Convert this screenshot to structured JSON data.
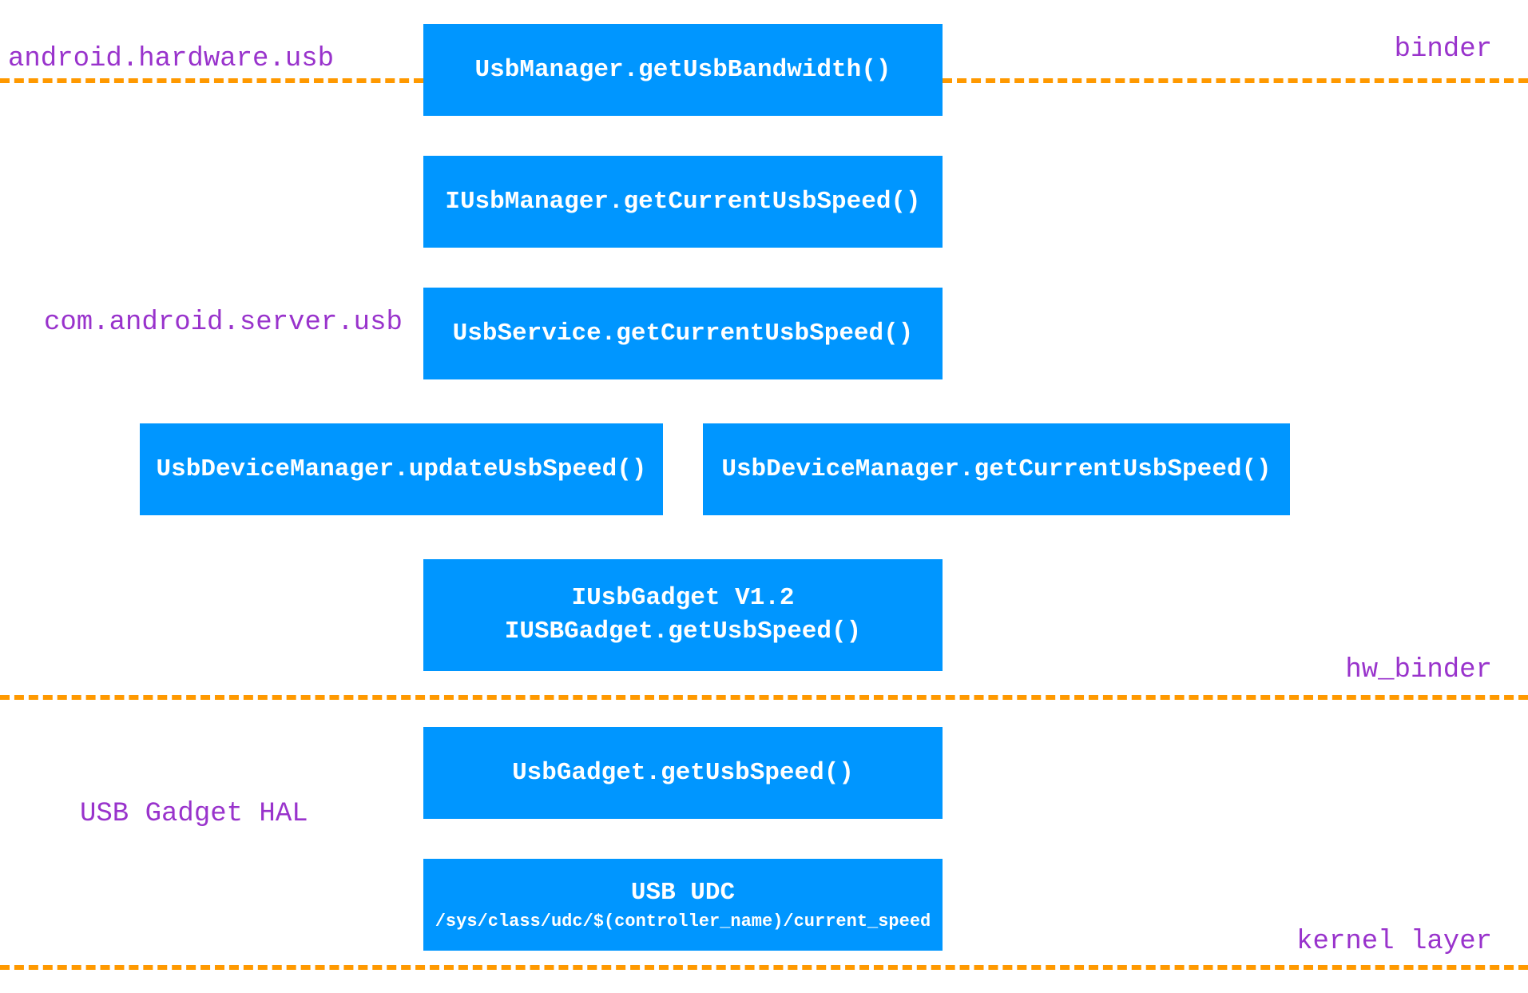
{
  "labels": {
    "android_hardware_usb": "android.hardware.usb",
    "binder": "binder",
    "com_android_server_usb": "com.android.server.usb",
    "hw_binder": "hw_binder",
    "usb_gadget_hal": "USB Gadget HAL",
    "kernel_layer": "kernel layer"
  },
  "boxes": {
    "usbmanager_getbandwidth": "UsbManager.getUsbBandwidth()",
    "iusbmanager_getcurrentspeed": "IUsbManager.getCurrentUsbSpeed()",
    "usbservice_getcurrentspeed": "UsbService.getCurrentUsbSpeed()",
    "usbdevicemanager_update": "UsbDeviceManager.updateUsbSpeed()",
    "usbdevicemanager_get": "UsbDeviceManager.getCurrentUsbSpeed()",
    "iusbgadget_title": "IUsbGadget V1.2",
    "iusbgadget_method": "IUSBGadget.getUsbSpeed()",
    "usbgadget_get": "UsbGadget.getUsbSpeed()",
    "usb_udc_title": "USB UDC",
    "usb_udc_path": "/sys/class/udc/$(controller_name)/current_speed"
  }
}
